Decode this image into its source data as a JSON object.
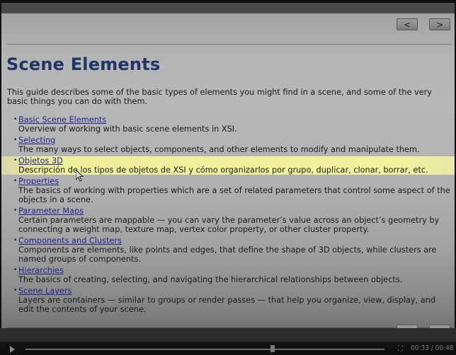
{
  "nav": {
    "prev_label": "<",
    "next_label": ">"
  },
  "page": {
    "title": "Scene Elements",
    "intro": "This guide describes some of the basic types of elements you might find in a scene, and some of the very basic things you can do with them.",
    "items": [
      {
        "link": "Basic Scene Elements",
        "desc": "Overview of working with basic scene elements in XSI."
      },
      {
        "link": "Selecting",
        "desc": "The many ways to select objects, components, and other elements to modify and manipulate them."
      },
      {
        "link": "Objetos 3D",
        "desc": "Descripción de los tipos de objetos de XSI y cómo organizarlos por grupo, duplicar, clonar, borrar, etc.",
        "highlighted": true
      },
      {
        "link": "Properties",
        "desc": "The basics of working with properties which are a set of related parameters that control some aspect of the objects in a scene."
      },
      {
        "link": "Parameter Maps",
        "desc": "Certain parameters are mappable — you can vary the parameter’s value across an object’s geometry by connecting a weight map, texture map, vertex color property, or other cluster property."
      },
      {
        "link": "Components and Clusters",
        "desc": "Components are elements, like points and edges, that define the shape of 3D objects, while clusters are named groups of components."
      },
      {
        "link": "Hierarchies",
        "desc": "The basics of creating, selecting, and navigating the hierarchical relationships between objects."
      },
      {
        "link": "Scene Layers",
        "desc": "Layers are containers — similar to groups or render passes — that help you organize, view, display, and edit the contents of your scene."
      }
    ]
  },
  "player": {
    "current_time": "00:33",
    "total_time": "00:48",
    "time_display": "00:33 / 00:48",
    "progress": 0.6875,
    "play_icon": "play-icon",
    "fullscreen_icon": "fullscreen-icon"
  },
  "colors": {
    "title": "#1f3565",
    "link": "#23238a",
    "highlight": "#f3f39e"
  }
}
